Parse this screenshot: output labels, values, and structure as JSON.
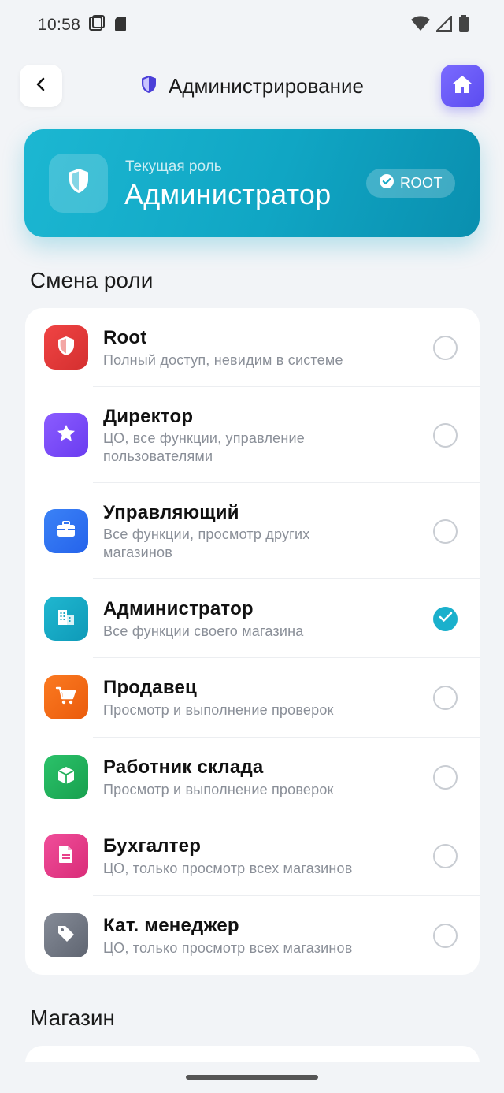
{
  "status_bar": {
    "time": "10:58"
  },
  "header": {
    "title": "Администрирование"
  },
  "current_role": {
    "label": "Текущая роль",
    "value": "Администратор",
    "badge": "ROOT"
  },
  "role_section": {
    "title": "Смена роли"
  },
  "roles": [
    {
      "name": "Root",
      "desc": "Полный доступ, невидим в системе",
      "icon": "shield-icon",
      "color": "#E53935",
      "selected": false
    },
    {
      "name": "Директор",
      "desc": "ЦО, все функции, управление пользователями",
      "icon": "star-icon",
      "color": "#7C4DFF",
      "selected": false
    },
    {
      "name": "Управляющий",
      "desc": "Все функции, просмотр других магазинов",
      "icon": "briefcase-icon",
      "color": "#2F6FED",
      "selected": false
    },
    {
      "name": "Администратор",
      "desc": "Все функции своего магазина",
      "icon": "building-icon",
      "color": "#1AA6C2",
      "selected": true
    },
    {
      "name": "Продавец",
      "desc": "Просмотр и выполнение проверок",
      "icon": "cart-icon",
      "color": "#F26A1B",
      "selected": false
    },
    {
      "name": "Работник склада",
      "desc": "Просмотр и выполнение проверок",
      "icon": "box-icon",
      "color": "#22B05A",
      "selected": false
    },
    {
      "name": "Бухгалтер",
      "desc": "ЦО, только просмотр всех магазинов",
      "icon": "document-icon",
      "color": "#E8418A",
      "selected": false
    },
    {
      "name": "Кат. менеджер",
      "desc": "ЦО, только просмотр всех магазинов",
      "icon": "tag-icon",
      "color": "#6F7582",
      "selected": false
    }
  ],
  "store_section": {
    "title": "Магазин"
  },
  "colors": {
    "accent": "#1AB0CC",
    "home_button": "#6A5AF5",
    "background": "#F2F4F7"
  }
}
